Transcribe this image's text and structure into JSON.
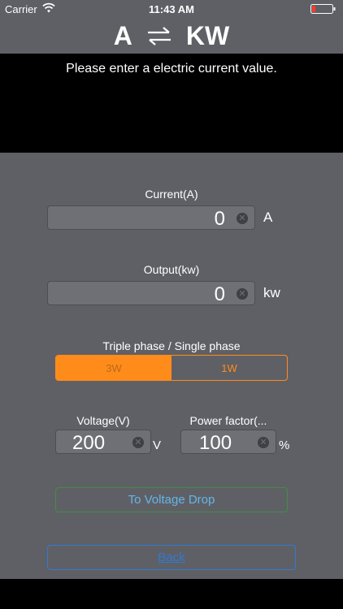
{
  "status_bar": {
    "carrier": "Carrier",
    "time": "11:43 AM"
  },
  "header": {
    "left": "A",
    "right": "KW",
    "swap_icon": "swap-arrows-icon"
  },
  "message": "Please enter a electric current value.",
  "current": {
    "label": "Current(A)",
    "value": "0",
    "unit": "A"
  },
  "output": {
    "label": "Output(kw)",
    "value": "0",
    "unit": "kw"
  },
  "phase": {
    "label": "Triple phase / Single phase",
    "options": [
      "3W",
      "1W"
    ],
    "selected": "3W"
  },
  "voltage": {
    "label": "Voltage(V)",
    "value": "200",
    "unit": "V"
  },
  "power_factor": {
    "label": "Power factor(...",
    "value": "100",
    "unit": "%"
  },
  "buttons": {
    "voltage_drop": "To Voltage Drop",
    "back": "Back"
  },
  "colors": {
    "accent": "#ff8c1a",
    "link_blue": "#2f7ad4",
    "green_border": "#3f8f3f",
    "background": "#5f6066"
  }
}
